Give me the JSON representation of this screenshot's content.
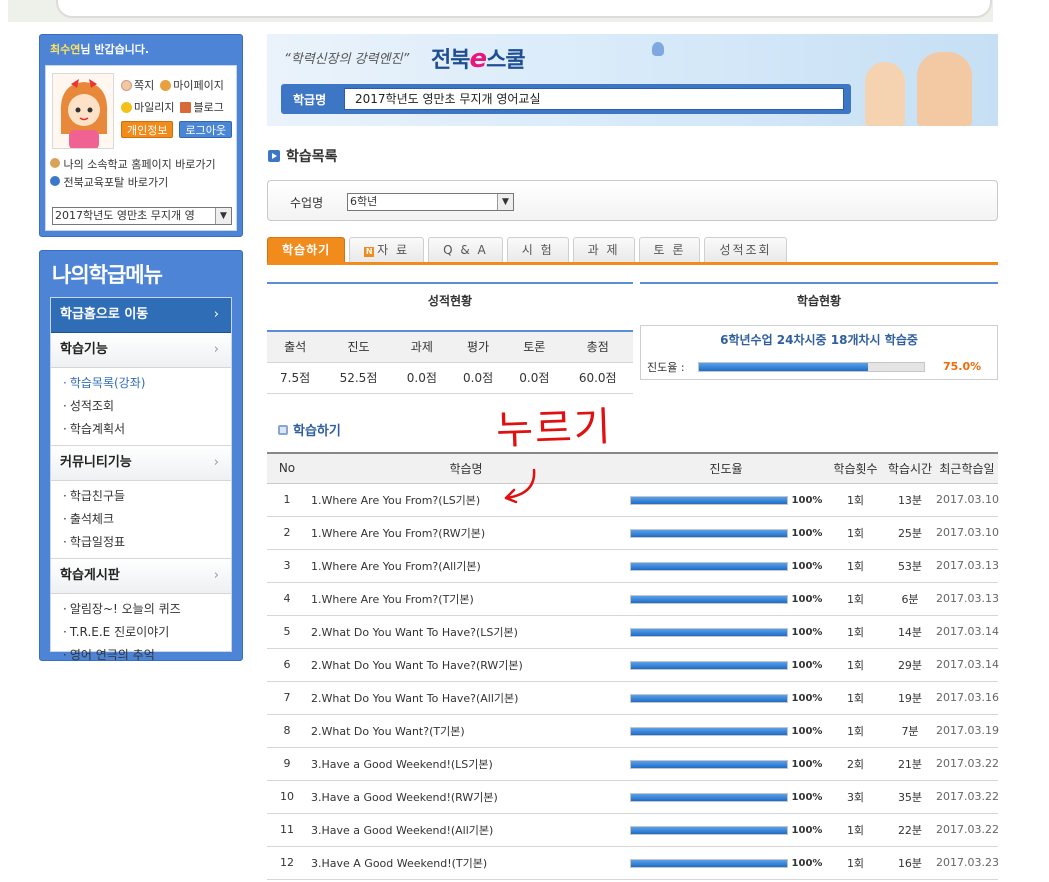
{
  "user": {
    "name": "최수연",
    "greeting_suffix": "님 반갑습니다.",
    "links": {
      "message": "쪽지",
      "mypage": "마이페이지",
      "mileage": "마일리지",
      "blog": "블로그"
    },
    "profile_button": "개인정보",
    "logout_button": "로그아웃",
    "school_home_link": "나의 소속학교 홈페이지 바로가기",
    "portal_link": "전북교육포탈 바로가기",
    "class_select_value": "2017학년도 영만초 무지개 영"
  },
  "menu": {
    "title": "나의학급메뉴",
    "home": "학급홈으로 이동",
    "sections": [
      {
        "label": "학습기능",
        "items": [
          "학습목록(강좌)",
          "성적조회",
          "학습계획서"
        ]
      },
      {
        "label": "커뮤니티기능",
        "items": [
          "학급친구들",
          "출석체크",
          "학급일정표"
        ]
      },
      {
        "label": "학습게시판",
        "items": [
          "알림장~! 오늘의 퀴즈",
          "T.R.E.E 진로이야기",
          "영어 연극의 추억"
        ]
      }
    ]
  },
  "banner": {
    "slogan": "“학력신장의 강력엔진”",
    "brand_left": "전북",
    "brand_e": "e",
    "brand_right": "스쿨",
    "class_label": "학급명",
    "class_name": "2017학년도 영만초 무지개 영어교실"
  },
  "page": {
    "title": "학습목록",
    "filter_label": "수업명",
    "filter_value": "6학년"
  },
  "tabs": [
    "학습하기",
    "자 료",
    "Q & A",
    "시 험",
    "과 제",
    "토 론",
    "성적조회"
  ],
  "grade": {
    "title": "성적현황",
    "headers": [
      "출석",
      "진도",
      "과제",
      "평가",
      "토론",
      "총점"
    ],
    "values": [
      "7.5점",
      "52.5점",
      "0.0점",
      "0.0점",
      "0.0점",
      "60.0점"
    ]
  },
  "study": {
    "title": "학습현황",
    "message": "6학년수업 24차시중 18개차시 학습중",
    "progress_label": "진도율 :",
    "progress_value": "75.0%",
    "progress_fraction": 0.75
  },
  "list": {
    "title": "학습하기",
    "headers": [
      "No",
      "학습명",
      "진도율",
      "학습횟수",
      "학습시간",
      "최근학습일"
    ],
    "rows": [
      {
        "no": "1",
        "name": "1.Where Are You From?(LS기본)",
        "pct": "100%",
        "count": "1회",
        "time": "13분",
        "date": "2017.03.10"
      },
      {
        "no": "2",
        "name": "1.Where Are You From?(RW기본)",
        "pct": "100%",
        "count": "1회",
        "time": "25분",
        "date": "2017.03.10"
      },
      {
        "no": "3",
        "name": "1.Where Are You From?(All기본)",
        "pct": "100%",
        "count": "1회",
        "time": "53분",
        "date": "2017.03.13"
      },
      {
        "no": "4",
        "name": "1.Where Are You From?(T기본)",
        "pct": "100%",
        "count": "1회",
        "time": "6분",
        "date": "2017.03.13"
      },
      {
        "no": "5",
        "name": "2.What Do You Want To Have?(LS기본)",
        "pct": "100%",
        "count": "1회",
        "time": "14분",
        "date": "2017.03.14"
      },
      {
        "no": "6",
        "name": "2.What Do You Want To Have?(RW기본)",
        "pct": "100%",
        "count": "1회",
        "time": "29분",
        "date": "2017.03.14"
      },
      {
        "no": "7",
        "name": "2.What Do You Want To Have?(All기본)",
        "pct": "100%",
        "count": "1회",
        "time": "19분",
        "date": "2017.03.16"
      },
      {
        "no": "8",
        "name": "2.What Do You Want?(T기본)",
        "pct": "100%",
        "count": "1회",
        "time": "7분",
        "date": "2017.03.19"
      },
      {
        "no": "9",
        "name": "3.Have a Good Weekend!(LS기본)",
        "pct": "100%",
        "count": "2회",
        "time": "21분",
        "date": "2017.03.22"
      },
      {
        "no": "10",
        "name": "3.Have a Good Weekend!(RW기본)",
        "pct": "100%",
        "count": "3회",
        "time": "35분",
        "date": "2017.03.22"
      },
      {
        "no": "11",
        "name": "3.Have a Good Weekend!(All기본)",
        "pct": "100%",
        "count": "1회",
        "time": "22분",
        "date": "2017.03.22"
      },
      {
        "no": "12",
        "name": "3.Have A Good Weekend!(T기본)",
        "pct": "100%",
        "count": "1회",
        "time": "16분",
        "date": "2017.03.23"
      }
    ]
  },
  "annotation": {
    "text": "누르기"
  },
  "colors": {
    "accent_orange": "#f18b1c",
    "accent_blue": "#3e76c6",
    "annotation_red": "#e01010"
  }
}
